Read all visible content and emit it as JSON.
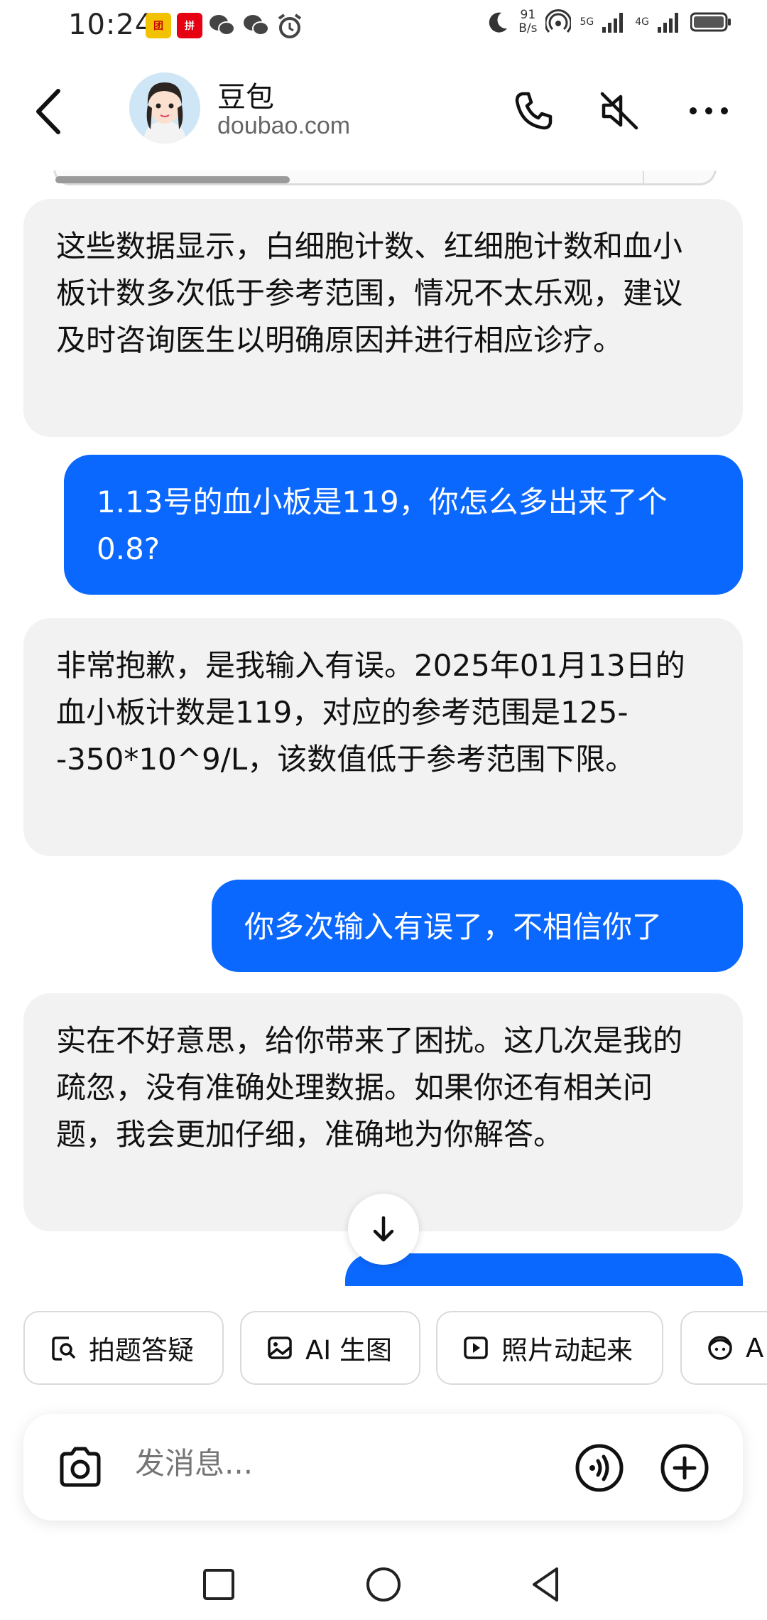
{
  "status_bar": {
    "time": "10:24",
    "net_speed_value": "91",
    "net_speed_unit": "B/s",
    "network_1": "5G",
    "network_2": "4G",
    "icons": [
      "app-icon-1",
      "app-icon-2",
      "wechat-icon",
      "wechat-icon",
      "alarm-icon",
      "moon-icon",
      "hotspot-icon",
      "signal-icon",
      "battery-icon"
    ]
  },
  "header": {
    "title": "豆包",
    "subtitle": "doubao.com",
    "icons": [
      "back-icon",
      "phone-icon",
      "mute-icon",
      "more-icon"
    ]
  },
  "messages": [
    {
      "role": "bot",
      "text": "这些数据显示，白细胞计数、红细胞计数和血小板计数多次低于参考范围，情况不太乐观，建议及时咨询医生以明确原因并进行相应诊疗。"
    },
    {
      "role": "user",
      "text": "1.13号的血小板是119，你怎么多出来了个0.8?"
    },
    {
      "role": "bot",
      "text": "非常抱歉，是我输入有误。2025年01月13日的血小板计数是119，对应的参考范围是125--350*10^9/L，该数值低于参考范围下限。"
    },
    {
      "role": "user",
      "text": "你多次输入有误了，不相信你了"
    },
    {
      "role": "bot",
      "text": "实在不好意思，给你带来了困扰。这几次是我的疏忽，没有准确处理数据。如果你还有相关问题，我会更加仔细，准确地为你解答。"
    }
  ],
  "chips": [
    {
      "label": "拍题答疑",
      "icon": "photo-search-icon"
    },
    {
      "label": "AI 生图",
      "icon": "image-icon"
    },
    {
      "label": "照片动起来",
      "icon": "play-icon"
    },
    {
      "label": "A",
      "icon": "face-icon"
    }
  ],
  "input": {
    "placeholder": "发消息..."
  },
  "colors": {
    "user_bubble": "#0b68ff",
    "bot_bubble": "#f2f2f3"
  }
}
